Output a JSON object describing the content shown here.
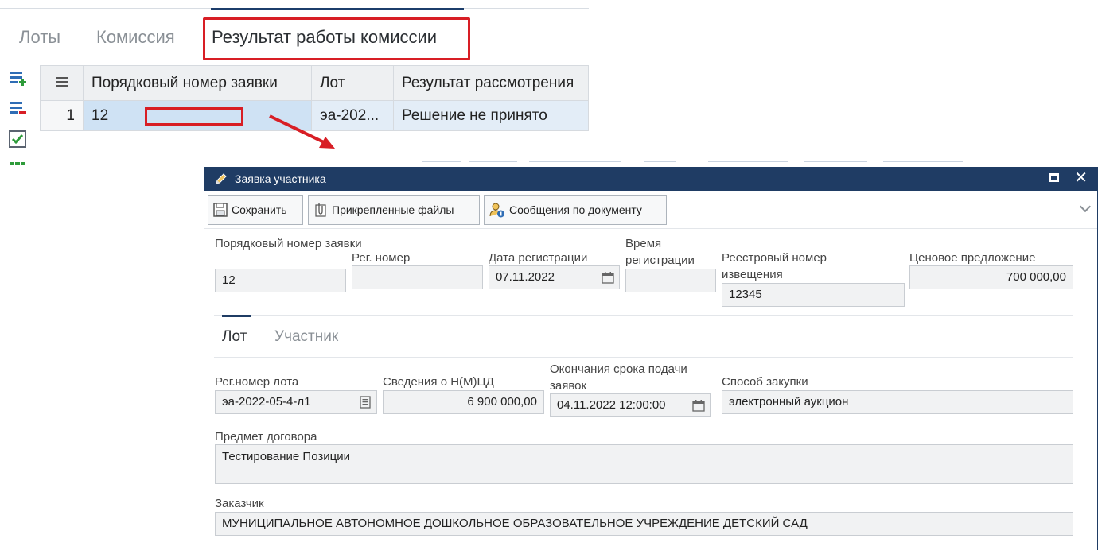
{
  "main": {
    "tabs": [
      {
        "label": "Лоты"
      },
      {
        "label": "Комиссия"
      },
      {
        "label": "Результат работы комиссии"
      }
    ],
    "grid": {
      "columns": [
        "Порядковый номер заявки",
        "Лот",
        "Результат рассмотрения"
      ],
      "rows": [
        {
          "num": "1",
          "application_no": "12",
          "lot": "эа-202...",
          "result": "Решение не принято"
        }
      ]
    },
    "tools": [
      "add-row-icon",
      "delete-row-icon",
      "check-icon"
    ]
  },
  "modal": {
    "title": "Заявка участника",
    "toolbar": {
      "save": "Сохранить",
      "files": "Прикрепленные файлы",
      "messages": "Сообщения по документу"
    },
    "fields": {
      "app_no_label": "Порядковый номер заявки",
      "app_no_value": "12",
      "reg_no_label": "Рег. номер",
      "reg_no_value": "",
      "reg_date_label": "Дата регистрации",
      "reg_date_value": "07.11.2022",
      "reg_time_label": "Время регистрации",
      "reg_time_value": "",
      "notice_no_label": "Реестровый номер извещения",
      "notice_no_value": "12345",
      "price_label": "Ценовое предложение",
      "price_value": "700 000,00"
    },
    "subtabs": [
      "Лот",
      "Участник"
    ],
    "lot": {
      "lot_no_label": "Рег.номер лота",
      "lot_no_value": "эа-2022-05-4-л1",
      "nmcd_label": "Сведения о Н(М)ЦД",
      "nmcd_value": "6 900 000,00",
      "deadline_label": "Окончания срока подачи заявок",
      "deadline_value": "04.11.2022 12:00:00",
      "method_label": "Способ закупки",
      "method_value": "электронный аукцион",
      "subject_label": "Предмет договора",
      "subject_value": "Тестирование Позиции",
      "customer_label": "Заказчик",
      "customer_value": "МУНИЦИПАЛЬНОЕ АВТОНОМНОЕ ДОШКОЛЬНОЕ ОБРАЗОВАТЕЛЬНОЕ УЧРЕЖДЕНИЕ  ДЕТСКИЙ САД"
    }
  },
  "colors": {
    "accent": "#1f3c64",
    "highlight": "#d81e25",
    "row_selected": "#cfe2f4"
  }
}
